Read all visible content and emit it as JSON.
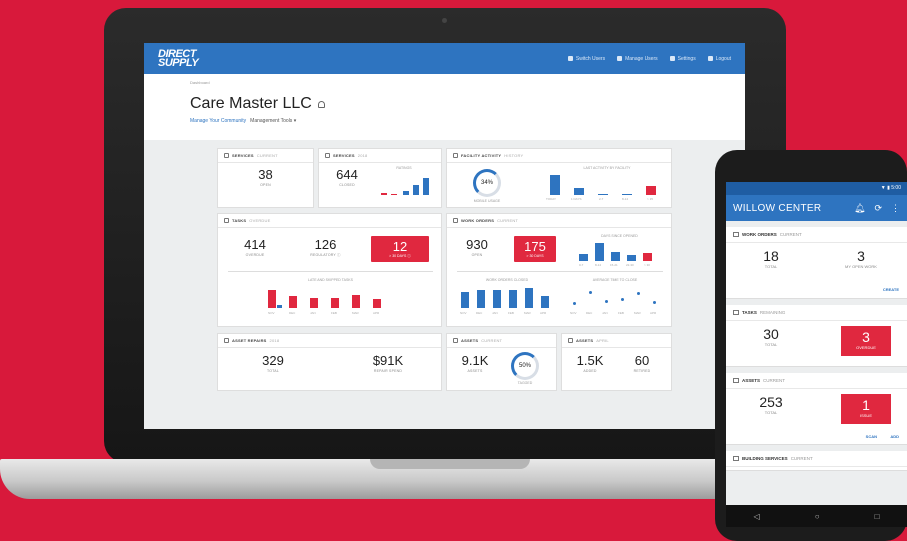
{
  "laptop": {
    "logo": [
      "DIRECT",
      "SUPPLY"
    ],
    "nav": [
      {
        "label": "Switch Users",
        "icon": "building-icon"
      },
      {
        "label": "Manage Users",
        "icon": "users-icon"
      },
      {
        "label": "Settings",
        "icon": "gear-icon"
      },
      {
        "label": "Logout",
        "icon": "logout-icon"
      }
    ],
    "breadcrumb": "Dashboard",
    "company": "Care Master LLC",
    "subnav": {
      "link": "Manage Your Community",
      "tools": "Management Tools ▾"
    },
    "services_current": {
      "title": "SERVICES",
      "sub": "CURRENT",
      "value": "38",
      "label": "OPEN"
    },
    "services_2018": {
      "title": "SERVICES",
      "sub": "2018",
      "value": "644",
      "label": "CLOSED",
      "chart_title": "RATINGS"
    },
    "facility": {
      "title": "FACILITY ACTIVITY",
      "sub": "HISTORY",
      "gauge": "34%",
      "gauge_label": "MOBILE USAGE",
      "chart_title": "LAST ACTIVITY BY FACILITY",
      "ticks": [
        "TODAY",
        "1 DAYS",
        "2-7",
        "8-14",
        "> 15"
      ]
    },
    "tasks": {
      "title": "TASKS",
      "sub": "OVERDUE",
      "overdue": "414",
      "overdue_label": "OVERDUE",
      "regulatory": "126",
      "regulatory_label": "REGULATORY ⓘ",
      "red_value": "12",
      "red_label": "> 30 DAYS ⓘ",
      "chart_title": "LATE AND SKIPPED TASKS",
      "ticks": [
        "NOV",
        "DEC",
        "JAN",
        "FEB",
        "MAR",
        "APR"
      ]
    },
    "work_orders": {
      "title": "WORK ORDERS",
      "sub": "CURRENT",
      "open": "930",
      "open_label": "OPEN",
      "red_value": "175",
      "red_label": "> 30 DAYS",
      "chart_title": "DAYS SINCE OPENED",
      "ticks": [
        "0-7",
        "8-14",
        "15-21",
        "22-30",
        "> 30"
      ],
      "closed_title": "WORK ORDERS CLOSED",
      "time_title": "AVERAGE TIME TO CLOSE",
      "month_ticks": [
        "NOV",
        "DEC",
        "JAN",
        "FEB",
        "MAR",
        "APR"
      ]
    },
    "asset_repairs": {
      "title": "ASSET REPAIRS",
      "sub": "2018",
      "total": "329",
      "total_label": "TOTAL",
      "spend": "$91K",
      "spend_label": "REPAIR SPEND"
    },
    "assets_current": {
      "title": "ASSETS",
      "sub": "CURRENT",
      "value": "9.1K",
      "label": "ASSETS",
      "gauge": "50%",
      "gauge_label": "TAGGED"
    },
    "assets_april": {
      "title": "ASSETS",
      "sub": "APRIL",
      "added": "1.5K",
      "added_label": "ADDED",
      "retired": "60",
      "retired_label": "RETIRED"
    }
  },
  "phone": {
    "status": "▼ ▮ 5:00",
    "title": "WILLOW CENTER",
    "icons": [
      "bell-icon",
      "refresh-icon",
      "menu-dots-icon"
    ],
    "work_orders": {
      "title": "WORK ORDERS",
      "sub": "CURRENT",
      "total": "18",
      "total_label": "TOTAL",
      "mine": "3",
      "mine_label": "MY OPEN WORK",
      "action": "CREATE"
    },
    "tasks": {
      "title": "TASKS",
      "sub": "REMAINING",
      "total": "30",
      "total_label": "TOTAL",
      "overdue": "3",
      "overdue_label": "OVERDUE"
    },
    "assets": {
      "title": "ASSETS",
      "sub": "CURRENT",
      "total": "253",
      "total_label": "TOTAL",
      "issue": "1",
      "issue_label": "ISSUE",
      "scan": "SCAN",
      "add": "ADD"
    },
    "building": {
      "title": "BUILDING SERVICES",
      "sub": "CURRENT"
    },
    "nav": [
      "◁",
      "○",
      "□"
    ]
  }
}
